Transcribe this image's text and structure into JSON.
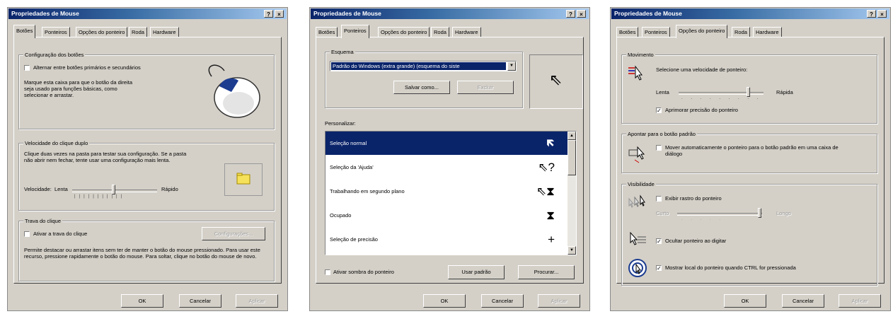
{
  "windows": [
    {
      "title": "Propriedades de Mouse",
      "tabs": [
        "Botões",
        "Ponteiros",
        "Opções do ponteiro",
        "Roda",
        "Hardware"
      ],
      "active_tab": 0,
      "button_config": {
        "group_label": "Configuração dos botões",
        "swap_checkbox_label": "Alternar entre botões primários e secundários",
        "swap_checked": false,
        "description": "Marque esta caixa para que o botão da direita seja usado para funções básicas, como selecionar e arrastar."
      },
      "double_click": {
        "group_label": "Velocidade do clique duplo",
        "description": "Clique duas vezes na pasta para testar sua configuração. Se a pasta não abrir nem fechar, tente usar uma configuração mais lenta.",
        "speed_label": "Velocidade:",
        "slow_label": "Lenta",
        "fast_label": "Rápido",
        "slider_level": 0.5
      },
      "click_lock": {
        "group_label": "Trava do clique",
        "checkbox_label": "Ativar a trava do clique",
        "checked": false,
        "settings_button": "Configurações...",
        "description": "Permite destacar ou arrastar itens sem ter de manter o botão do mouse pressionado. Para usar este recurso, pressione rapidamente o botão do mouse. Para soltar, clique no botão do mouse de novo."
      },
      "buttons": {
        "ok": "OK",
        "cancel": "Cancelar",
        "apply": "Aplicar"
      }
    },
    {
      "title": "Propriedades de Mouse",
      "tabs": [
        "Botões",
        "Ponteiros",
        "Opções do ponteiro",
        "Roda",
        "Hardware"
      ],
      "active_tab": 1,
      "scheme": {
        "group_label": "Esquema",
        "selected_value": "Padrão do Windows (extra grande) (esquema do siste",
        "save_button": "Salvar como...",
        "delete_button": "Excluir"
      },
      "customize_label": "Personalizar:",
      "cursors": [
        {
          "label": "Seleção normal",
          "icon": "arrow-cursor-icon",
          "glyph": "🡼",
          "selected": true
        },
        {
          "label": "Seleção da 'Ajuda'",
          "icon": "help-cursor-icon",
          "glyph": "⇖?",
          "selected": false
        },
        {
          "label": "Trabalhando em segundo plano",
          "icon": "working-cursor-icon",
          "glyph": "⇖⧗",
          "selected": false
        },
        {
          "label": "Ocupado",
          "icon": "hourglass-cursor-icon",
          "glyph": "⧗",
          "selected": false
        },
        {
          "label": "Seleção de precisão",
          "icon": "crosshair-cursor-icon",
          "glyph": "+",
          "selected": false
        }
      ],
      "shadow_checkbox_label": "Ativar sombra do ponteiro",
      "shadow_checked": false,
      "default_button": "Usar padrão",
      "browse_button": "Procurar...",
      "buttons": {
        "ok": "OK",
        "cancel": "Cancelar",
        "apply": "Aplicar"
      }
    },
    {
      "title": "Propriedades de Mouse",
      "tabs": [
        "Botões",
        "Ponteiros",
        "Opções do ponteiro",
        "Roda",
        "Hardware"
      ],
      "active_tab": 2,
      "motion": {
        "group_label": "Movimento",
        "speed_prompt": "Selecione uma velocidade de ponteiro:",
        "slow_label": "Lenta",
        "fast_label": "Rápida",
        "slider_level": 0.8,
        "precision_label": "Aprimorar precisão do ponteiro",
        "precision_checked": true
      },
      "snap_to": {
        "group_label": "Apontar para o botão padrão",
        "checkbox_label": "Mover automaticamente o ponteiro para o botão padrão em uma caixa de diálogo",
        "checked": false
      },
      "visibility": {
        "group_label": "Visibilidade",
        "trails_label": "Exibir rastro do ponteiro",
        "trails_checked": false,
        "short_label": "Curto",
        "long_label": "Longo",
        "trails_level": 0.95,
        "hide_label": "Ocultar ponteiro ao digitar",
        "hide_checked": true,
        "ctrl_label": "Mostrar local do ponteiro quando CTRL for pressionada",
        "ctrl_checked": true
      },
      "buttons": {
        "ok": "OK",
        "cancel": "Cancelar",
        "apply": "Aplicar"
      }
    }
  ]
}
